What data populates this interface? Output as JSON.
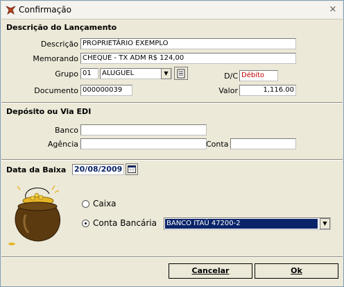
{
  "window": {
    "title": "Confirmação",
    "close_glyph": "×"
  },
  "lancamento": {
    "section_title": "Descrição do Lançamento",
    "descricao_label": "Descrição",
    "descricao_value": "PROPRIETÁRIO EXEMPLO",
    "memorando_label": "Memorando",
    "memorando_value": "CHEQUE - TX ADM R$ 124,00",
    "grupo_label": "Grupo",
    "grupo_code": "01",
    "grupo_value": "ALUGUEL",
    "dc_label": "D/C",
    "dc_value": "Débito",
    "documento_label": "Documento",
    "documento_value": "000000039",
    "valor_label": "Valor",
    "valor_value": "1,116.00"
  },
  "deposito": {
    "section_title": "Depósito ou Via EDI",
    "banco_label": "Banco",
    "banco_value": "",
    "agencia_label": "Agência",
    "agencia_value": "",
    "conta_label": "Conta",
    "conta_value": ""
  },
  "baixa": {
    "section_title": "Data da Baixa",
    "data_value": "20/08/2009",
    "caixa_label": "Caixa",
    "caixa_selected": false,
    "conta_bancaria_label": "Conta Bancária",
    "conta_bancaria_selected": true,
    "conta_bancaria_value": "BANCO ITAÚ   47200-2"
  },
  "buttons": {
    "cancelar": "Cancelar",
    "ok": "Ok"
  },
  "colors": {
    "debit_text": "#c00000",
    "selection_bg": "#0a246a"
  },
  "icons": [
    "app-icon",
    "close-icon",
    "chevron-down-icon",
    "document-icon",
    "calendar-icon",
    "gold-pot-icon"
  ]
}
